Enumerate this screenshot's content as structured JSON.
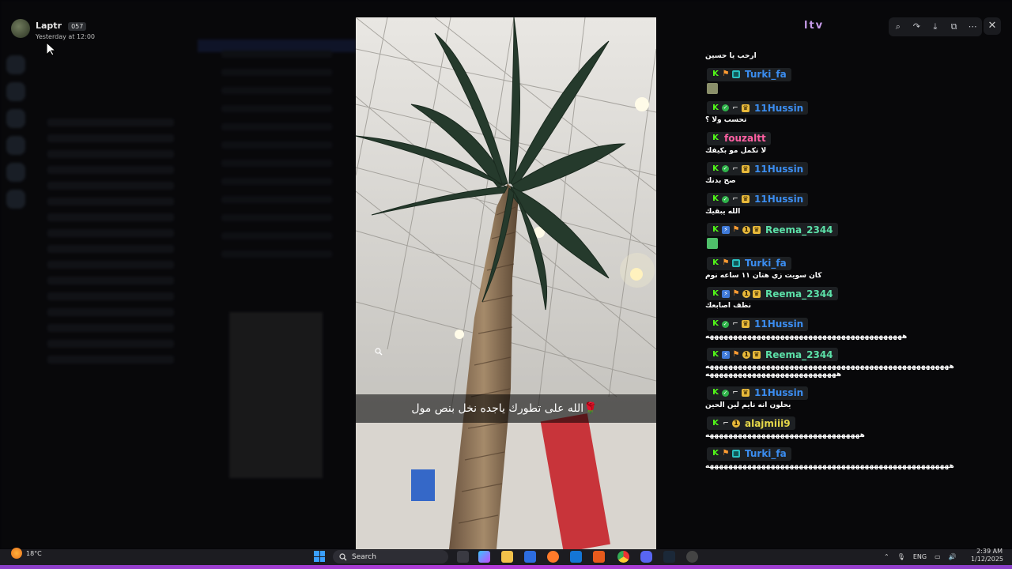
{
  "viewer": {
    "author_name": "Laptr",
    "author_badge": "057",
    "timestamp": "Yesterday at 12:00"
  },
  "media": {
    "caption": "الله على تطورك ياجده نخل بنص مول",
    "caption_emoji": "🌹"
  },
  "toolbar": {
    "icons": [
      "zoom-icon",
      "forward-icon",
      "download-icon",
      "open-external-icon",
      "more-icon"
    ],
    "close_label": "✕"
  },
  "brand_logo": "ltv",
  "chat": {
    "colors": {
      "turki": "#3b8df0",
      "hussin": "#3b8df0",
      "fouz": "#ff5fa2",
      "reema": "#5ce0a8",
      "alaj": "#e6d84a"
    },
    "messages": [
      {
        "user": "",
        "text": "ارحب يا حسين",
        "badges": []
      },
      {
        "user": "Turki_fa",
        "color_key": "turki",
        "badges": [
          "k",
          "flag",
          "gift"
        ],
        "text": "",
        "emote": true
      },
      {
        "user": "11Hussin",
        "color_key": "hussin",
        "badges": [
          "k",
          "check",
          "hook",
          "crown"
        ],
        "text": "تحسب ولا ؟"
      },
      {
        "user": "fouzaltt",
        "color_key": "fouz",
        "badges": [
          "k"
        ],
        "text": "لا تكمل مو بكيفك"
      },
      {
        "user": "11Hussin",
        "color_key": "hussin",
        "badges": [
          "k",
          "check",
          "hook",
          "crown"
        ],
        "text": "صح بدنك"
      },
      {
        "user": "11Hussin",
        "color_key": "hussin",
        "badges": [
          "k",
          "check",
          "hook",
          "crown"
        ],
        "text": "الله يبقيك"
      },
      {
        "user": "Reema_2344",
        "color_key": "reema",
        "badges": [
          "k",
          "bolt",
          "flag",
          "one",
          "crown"
        ],
        "text": "",
        "emote": true
      },
      {
        "user": "Turki_fa",
        "color_key": "turki",
        "badges": [
          "k",
          "flag",
          "gift"
        ],
        "text": "كان سويت زي هتان ١١ ساعه نوم"
      },
      {
        "user": "Reema_2344",
        "color_key": "reema",
        "badges": [
          "k",
          "bolt",
          "flag",
          "one",
          "crown"
        ],
        "text": "نظف اصابعك"
      },
      {
        "user": "11Hussin",
        "color_key": "hussin",
        "badges": [
          "k",
          "check",
          "hook",
          "crown"
        ],
        "text": "ههههههههههههههههههههههههههههههههههههههههههه"
      },
      {
        "user": "Reema_2344",
        "color_key": "reema",
        "badges": [
          "k",
          "bolt",
          "flag",
          "one",
          "crown"
        ],
        "text": "ههههههههههههههههههههههههههههههههههههههههههههههههههههه ههههههههههههههههههههههههههههه"
      },
      {
        "user": "11Hussin",
        "color_key": "hussin",
        "badges": [
          "k",
          "check",
          "hook",
          "crown"
        ],
        "text": "يحلون انه نايم لين الحين"
      },
      {
        "user": "alajmiii9",
        "color_key": "alaj",
        "badges": [
          "k",
          "hook",
          "one"
        ],
        "text": "هههههههههههههههههههههههههههههههههه"
      },
      {
        "user": "Turki_fa",
        "color_key": "turki",
        "badges": [
          "k",
          "flag",
          "gift"
        ],
        "text": "ههههههههههههههههههههههههههههههههههههههههههههههههههههه"
      }
    ]
  },
  "taskbar": {
    "temperature": "18°C",
    "search_placeholder": "Search",
    "language": "ENG",
    "time": "2:39 AM",
    "date": "1/12/2025"
  }
}
